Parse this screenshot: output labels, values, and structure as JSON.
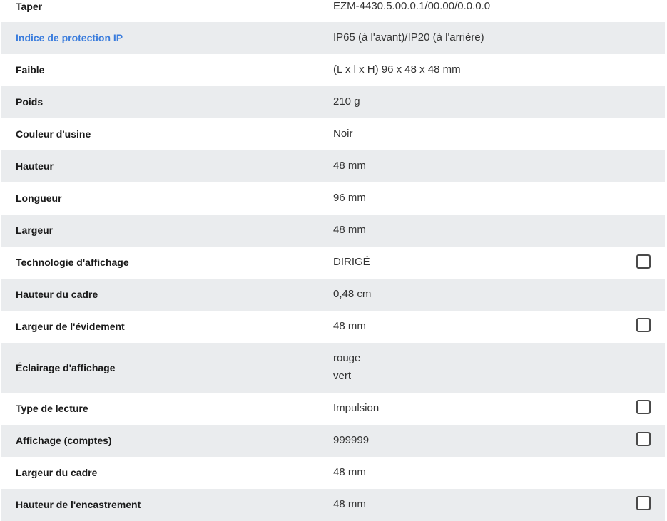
{
  "specs": [
    {
      "label": "Taper",
      "value": "EZM-4430.5.00.0.1/00.00/0.0.0.0"
    },
    {
      "label": "Indice de protection IP",
      "value": "IP65 (à l'avant)/IP20 (à l'arrière)"
    },
    {
      "label": "Faible",
      "value": "(L x l x H) 96 x 48 x 48 mm"
    },
    {
      "label": "Poids",
      "value": "210 g"
    },
    {
      "label": "Couleur d'usine",
      "value": "Noir"
    },
    {
      "label": "Hauteur",
      "value": "48 mm"
    },
    {
      "label": "Longueur",
      "value": "96 mm"
    },
    {
      "label": "Largeur",
      "value": "48 mm"
    },
    {
      "label": "Technologie d'affichage",
      "value": "DIRIGÉ"
    },
    {
      "label": "Hauteur du cadre",
      "value": "0,48 cm"
    },
    {
      "label": "Largeur de l'évidement",
      "value": "48 mm"
    },
    {
      "label": "Éclairage d'affichage",
      "values": [
        "rouge",
        "vert"
      ]
    },
    {
      "label": "Type de lecture",
      "value": "Impulsion"
    },
    {
      "label": "Affichage (comptes)",
      "value": "999999"
    },
    {
      "label": "Largeur du cadre",
      "value": "48 mm"
    },
    {
      "label": "Hauteur de l'encastrement",
      "value": "48 mm"
    }
  ]
}
